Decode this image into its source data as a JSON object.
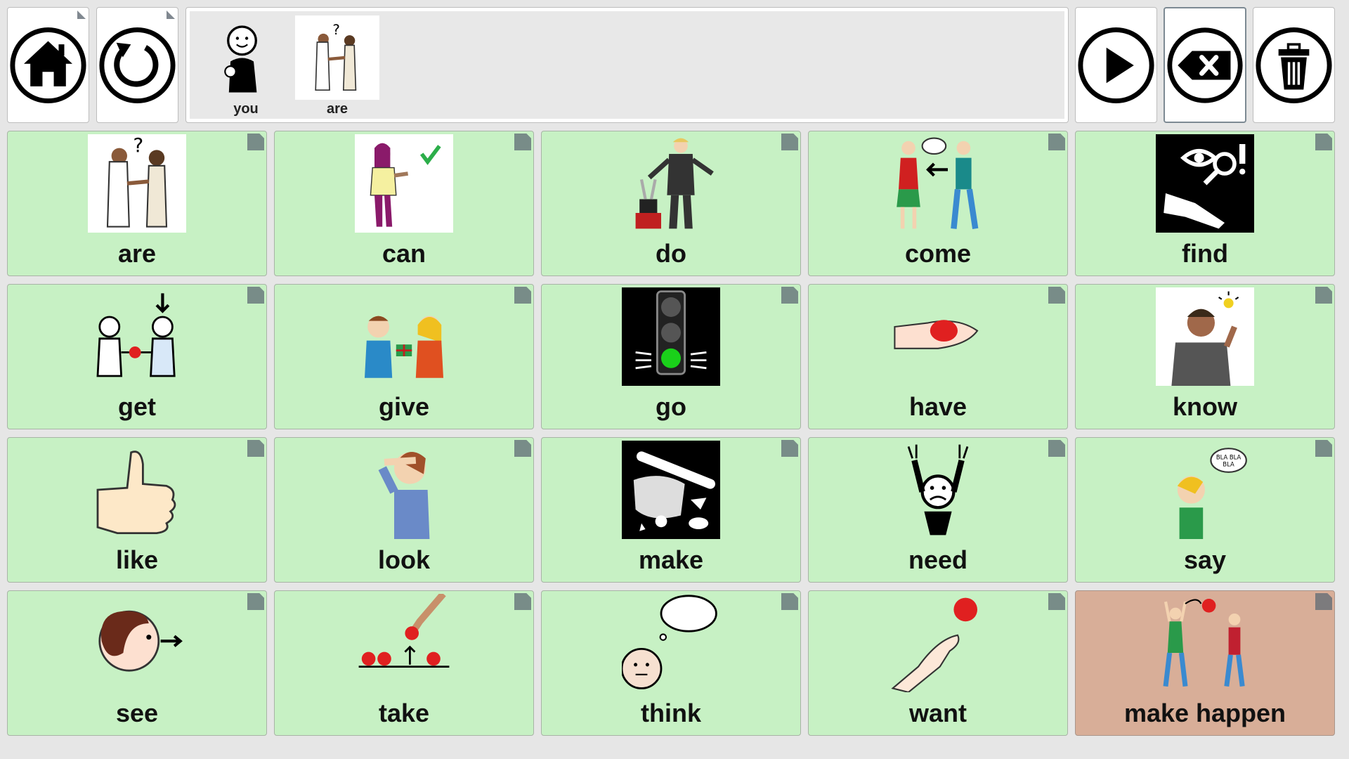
{
  "toolbar": {
    "home_icon": "home-icon",
    "undo_icon": "undo-icon",
    "play_icon": "play-icon",
    "backspace_icon": "backspace-icon",
    "clear_icon": "trash-icon"
  },
  "sentence": {
    "words": [
      {
        "label": "you",
        "icon": "you-icon"
      },
      {
        "label": "are",
        "icon": "are-icon"
      }
    ]
  },
  "grid": {
    "cells": [
      {
        "label": "are",
        "icon": "are-icon"
      },
      {
        "label": "can",
        "icon": "can-icon"
      },
      {
        "label": "do",
        "icon": "do-icon"
      },
      {
        "label": "come",
        "icon": "come-icon"
      },
      {
        "label": "find",
        "icon": "find-icon"
      },
      {
        "label": "get",
        "icon": "get-icon"
      },
      {
        "label": "give",
        "icon": "give-icon"
      },
      {
        "label": "go",
        "icon": "go-icon"
      },
      {
        "label": "have",
        "icon": "have-icon"
      },
      {
        "label": "know",
        "icon": "know-icon"
      },
      {
        "label": "like",
        "icon": "like-icon"
      },
      {
        "label": "look",
        "icon": "look-icon"
      },
      {
        "label": "make",
        "icon": "make-icon"
      },
      {
        "label": "need",
        "icon": "need-icon"
      },
      {
        "label": "say",
        "icon": "say-icon"
      },
      {
        "label": "see",
        "icon": "see-icon"
      },
      {
        "label": "take",
        "icon": "take-icon"
      },
      {
        "label": "think",
        "icon": "think-icon"
      },
      {
        "label": "want",
        "icon": "want-icon"
      },
      {
        "label": "make happen",
        "icon": "make-happen-icon"
      }
    ]
  },
  "colors": {
    "cell_green": "#c7f1c4",
    "cell_orange": "#d8ae98",
    "background": "#e6e6e6"
  }
}
